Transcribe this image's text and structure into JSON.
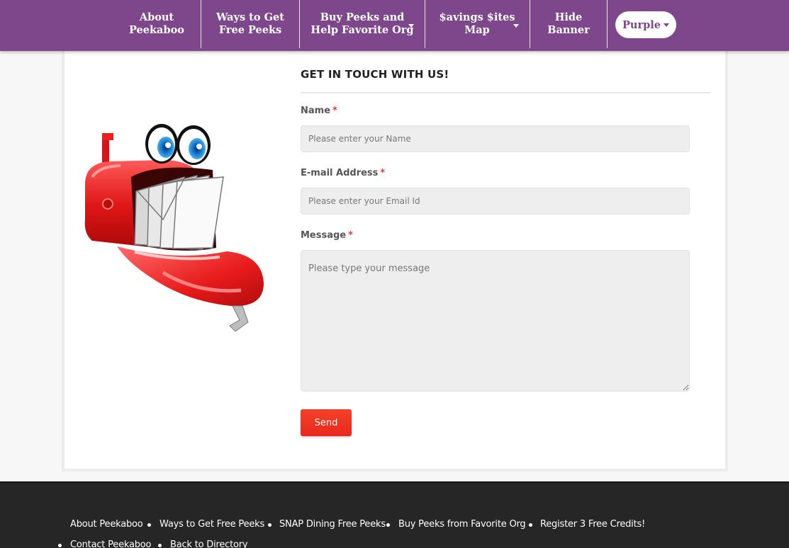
{
  "nav": {
    "items": [
      {
        "line1": "About",
        "line2": "Peekaboo"
      },
      {
        "line1": "Ways to Get",
        "line2": "Free Peeks"
      },
      {
        "line1": "Buy Peeks and",
        "line2": "Help Favorite Org"
      },
      {
        "line1": "$avings $ites",
        "line2": "Map"
      },
      {
        "line1": "Hide",
        "line2": "Banner"
      }
    ],
    "theme_label": "Purple"
  },
  "form": {
    "title": "GET IN TOUCH WITH US!",
    "name_label": "Name",
    "name_placeholder": "Please enter your Name",
    "email_label": "E-mail Address",
    "email_placeholder": "Please enter your Email Id",
    "message_label": "Message",
    "message_placeholder": "Please type your message",
    "required_mark": "*",
    "send_label": "Send"
  },
  "footer": {
    "links": [
      "About Peekaboo",
      "Ways to Get Free Peeks",
      "SNAP Dining Free Peeks",
      "Buy Peeks from Favorite Org",
      "Register 3 Free Credits!",
      "Contact Peekaboo",
      "Back to Directory"
    ]
  },
  "colors": {
    "nav_bg": "#7e478c",
    "send_button": "#f0301f",
    "footer_bg": "#262626",
    "required": "#e53935"
  }
}
